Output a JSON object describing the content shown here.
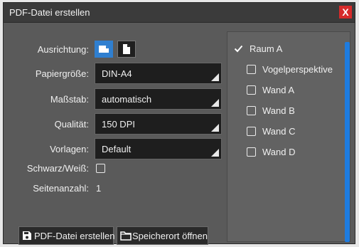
{
  "dialog": {
    "title": "PDF-Datei erstellen",
    "close_label": "X"
  },
  "settings": {
    "orientation_label": "Ausrichtung:",
    "paper_size_label": "Papiergröße:",
    "paper_size_value": "DIN-A4",
    "scale_label": "Maßstab:",
    "scale_value": "automatisch",
    "quality_label": "Qualität:",
    "quality_value": "150 DPI",
    "templates_label": "Vorlagen:",
    "templates_value": "Default",
    "bw_label": "Schwarz/Weiß:",
    "page_count_label": "Seitenanzahl:",
    "page_count_value": "1"
  },
  "views": {
    "items": [
      {
        "label": "Raum A",
        "checked": true
      },
      {
        "label": "Vogelperspektive",
        "checked": false
      },
      {
        "label": "Wand A",
        "checked": false
      },
      {
        "label": "Wand B",
        "checked": false
      },
      {
        "label": "Wand C",
        "checked": false
      },
      {
        "label": "Wand D",
        "checked": false
      }
    ]
  },
  "buttons": {
    "create_pdf": "PDF-Datei erstellen",
    "open_location": "Speicherort öffnen"
  },
  "colors": {
    "accent": "#1e7ce0",
    "close": "#d62a2a",
    "background": "#5a5a5a"
  }
}
